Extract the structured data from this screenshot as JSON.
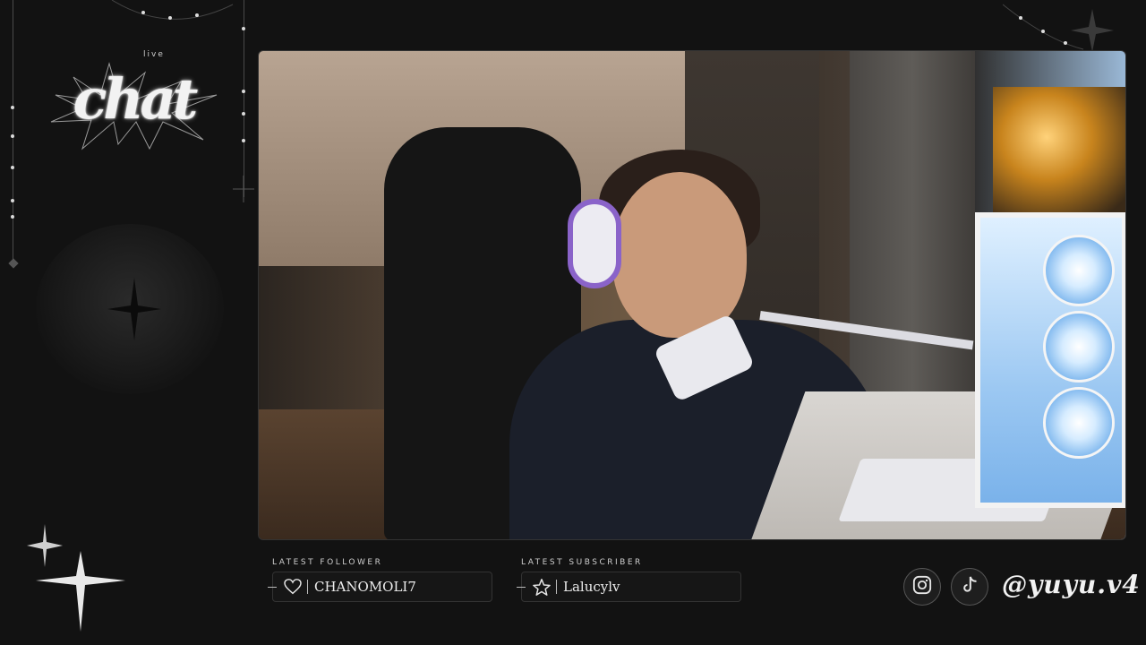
{
  "overlay": {
    "logo_small": "live",
    "logo_text": "chat"
  },
  "stream": {
    "description": "webcam feed"
  },
  "latest_follower": {
    "label": "LATEST FOLLOWER",
    "name": "CHANOMOLI7",
    "icon": "heart-icon"
  },
  "latest_subscriber": {
    "label": "LATEST SUBSCRIBER",
    "name": "Lalucylv",
    "icon": "star-icon"
  },
  "social": {
    "instagram_icon": "instagram-icon",
    "tiktok_icon": "tiktok-icon",
    "handle": "@yuyu.v4"
  },
  "colors": {
    "background": "#121212",
    "accent": "#e6e6e6",
    "headphone_accent": "#8a63c9",
    "pc_glow": "#9cc8f2"
  }
}
